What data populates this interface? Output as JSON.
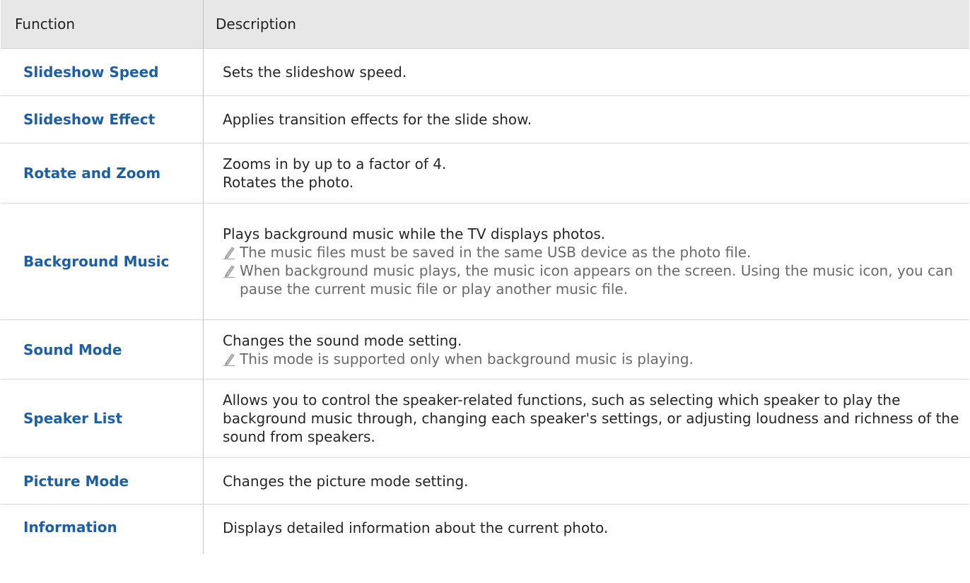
{
  "header": {
    "function": "Function",
    "description": "Description"
  },
  "rows": [
    {
      "function": "Slideshow Speed",
      "lines": [
        "Sets the slideshow speed."
      ]
    },
    {
      "function": "Slideshow Effect",
      "lines": [
        "Applies transition effects for the slide show."
      ]
    },
    {
      "function": "Rotate and Zoom",
      "lines": [
        "Zooms in by up to a factor of 4.",
        "Rotates the photo."
      ]
    },
    {
      "function": "Background Music",
      "lines": [
        "Plays background music while the TV displays photos."
      ],
      "notes": [
        "The music files must be saved in the same USB device as the photo file.",
        "When background music plays, the music icon appears on the screen. Using the music icon, you can pause the current music file or play another music file."
      ]
    },
    {
      "function": "Sound Mode",
      "lines": [
        "Changes the sound mode setting."
      ],
      "notes": [
        "This mode is supported only when background music is playing."
      ]
    },
    {
      "function": "Speaker List",
      "lines": [
        "Allows you to control the speaker-related functions, such as selecting which speaker to play the background music through, changing each speaker's settings, or adjusting loudness and richness of the sound from speakers."
      ]
    },
    {
      "function": "Picture Mode",
      "lines": [
        "Changes the picture mode setting."
      ]
    },
    {
      "function": "Information",
      "lines": [
        "Displays detailed information about the current photo."
      ]
    }
  ],
  "icons": {
    "note": "pencil-note-icon"
  },
  "colors": {
    "function_text": "#1a5fa8",
    "header_bg": "#e7e7e7",
    "note_text": "#6a6a6a"
  }
}
